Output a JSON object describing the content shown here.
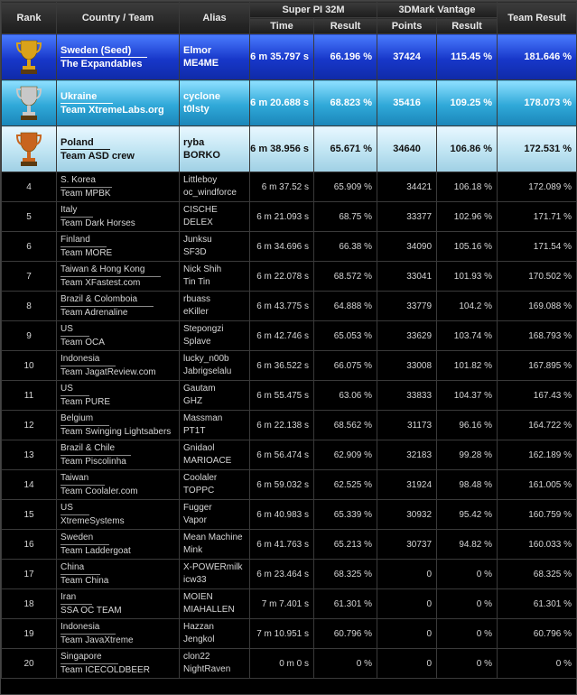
{
  "header": {
    "rank": "Rank",
    "country_team": "Country / Team",
    "alias": "Alias",
    "superpi": "Super PI 32M",
    "vantage": "3DMark Vantage",
    "team_result": "Team Result",
    "time": "Time",
    "result": "Result",
    "points": "Points",
    "result2": "Result"
  },
  "colors": {
    "gold": "#d9a21a",
    "silver": "#c8c8c8",
    "bronze": "#c8641e"
  },
  "podium": [
    {
      "icon": "gold-trophy-icon",
      "country": "Sweden (Seed)",
      "team": "The Expandables",
      "alias1": "Elmor",
      "alias2": "ME4ME",
      "time": "6 m 35.797 s",
      "spi": "66.196 %",
      "points": "37424",
      "vres": "115.45 %",
      "team_result": "181.646 %"
    },
    {
      "icon": "silver-trophy-icon",
      "country": "Ukraine",
      "team": "Team XtremeLabs.org",
      "alias1": "cyclone",
      "alias2": "t0lsty",
      "time": "6 m 20.688 s",
      "spi": "68.823 %",
      "points": "35416",
      "vres": "109.25 %",
      "team_result": "178.073 %"
    },
    {
      "icon": "bronze-trophy-icon",
      "country": "Poland",
      "team": "Team ASD crew",
      "alias1": "ryba",
      "alias2": "BORKO",
      "time": "6 m 38.956 s",
      "spi": "65.671 %",
      "points": "34640",
      "vres": "106.86 %",
      "team_result": "172.531 %"
    }
  ],
  "rows": [
    {
      "rank": "4",
      "country": "S. Korea",
      "team": "Team MPBK",
      "alias1": "Littleboy",
      "alias2": "oc_windforce",
      "time": "6 m 37.52 s",
      "spi": "65.909 %",
      "points": "34421",
      "vres": "106.18 %",
      "team_result": "172.089 %"
    },
    {
      "rank": "5",
      "country": "Italy",
      "team": "Team Dark Horses",
      "alias1": "CISCHE",
      "alias2": "DELEX",
      "time": "6 m 21.093 s",
      "spi": "68.75 %",
      "points": "33377",
      "vres": "102.96 %",
      "team_result": "171.71 %"
    },
    {
      "rank": "6",
      "country": "Finland",
      "team": "Team MORE",
      "alias1": "Junksu",
      "alias2": "SF3D",
      "time": "6 m 34.696 s",
      "spi": "66.38 %",
      "points": "34090",
      "vres": "105.16 %",
      "team_result": "171.54 %"
    },
    {
      "rank": "7",
      "country": "Taiwan & Hong Kong",
      "team": "Team XFastest.com",
      "alias1": "Nick Shih",
      "alias2": "Tin Tin",
      "time": "6 m 22.078 s",
      "spi": "68.572 %",
      "points": "33041",
      "vres": "101.93 %",
      "team_result": "170.502 %"
    },
    {
      "rank": "8",
      "country": "Brazil & Colomboia",
      "team": "Team Adrenaline",
      "alias1": "rbuass",
      "alias2": "eKiller",
      "time": "6 m 43.775 s",
      "spi": "64.888 %",
      "points": "33779",
      "vres": "104.2 %",
      "team_result": "169.088 %"
    },
    {
      "rank": "9",
      "country": "US",
      "team": "Team OCA",
      "alias1": "Stepongzi",
      "alias2": "Splave",
      "time": "6 m 42.746 s",
      "spi": "65.053 %",
      "points": "33629",
      "vres": "103.74 %",
      "team_result": "168.793 %"
    },
    {
      "rank": "10",
      "country": "Indonesia",
      "team": "Team JagatReview.com",
      "alias1": "lucky_n00b",
      "alias2": "Jabrigselalu",
      "time": "6 m 36.522 s",
      "spi": "66.075 %",
      "points": "33008",
      "vres": "101.82 %",
      "team_result": "167.895 %"
    },
    {
      "rank": "11",
      "country": "US",
      "team": "Team PURE",
      "alias1": "Gautam",
      "alias2": "GHZ",
      "time": "6 m 55.475 s",
      "spi": "63.06 %",
      "points": "33833",
      "vres": "104.37 %",
      "team_result": "167.43 %"
    },
    {
      "rank": "12",
      "country": "Belgium",
      "team": "Team Swinging Lightsabers",
      "alias1": "Massman",
      "alias2": "PT1T",
      "time": "6 m 22.138 s",
      "spi": "68.562 %",
      "points": "31173",
      "vres": "96.16 %",
      "team_result": "164.722 %"
    },
    {
      "rank": "13",
      "country": "Brazil & Chile",
      "team": "Team Piscolinha",
      "alias1": "Gnidaol",
      "alias2": "MARIOACE",
      "time": "6 m 56.474 s",
      "spi": "62.909 %",
      "points": "32183",
      "vres": "99.28 %",
      "team_result": "162.189 %"
    },
    {
      "rank": "14",
      "country": "Taiwan",
      "team": "Team Coolaler.com",
      "alias1": "Coolaler",
      "alias2": "TOPPC",
      "time": "6 m 59.032 s",
      "spi": "62.525 %",
      "points": "31924",
      "vres": "98.48 %",
      "team_result": "161.005 %"
    },
    {
      "rank": "15",
      "country": "US",
      "team": "XtremeSystems",
      "alias1": "Fugger",
      "alias2": "Vapor",
      "time": "6 m 40.983 s",
      "spi": "65.339 %",
      "points": "30932",
      "vres": "95.42 %",
      "team_result": "160.759 %"
    },
    {
      "rank": "16",
      "country": "Sweden",
      "team": "Team Laddergoat",
      "alias1": "Mean Machine",
      "alias2": "Mink",
      "time": "6 m 41.763 s",
      "spi": "65.213 %",
      "points": "30737",
      "vres": "94.82 %",
      "team_result": "160.033 %"
    },
    {
      "rank": "17",
      "country": "China",
      "team": "Team China",
      "alias1": "X-POWERmilk",
      "alias2": "icw33",
      "time": "6 m 23.464 s",
      "spi": "68.325 %",
      "points": "0",
      "vres": "0 %",
      "team_result": "68.325 %"
    },
    {
      "rank": "18",
      "country": "Iran",
      "team": "SSA OC TEAM",
      "alias1": "MOIEN",
      "alias2": "MIAHALLEN",
      "time": "7 m 7.401 s",
      "spi": "61.301 %",
      "points": "0",
      "vres": "0 %",
      "team_result": "61.301 %"
    },
    {
      "rank": "19",
      "country": "Indonesia",
      "team": "Team JavaXtreme",
      "alias1": "Hazzan",
      "alias2": "Jengkol",
      "time": "7 m 10.951 s",
      "spi": "60.796 %",
      "points": "0",
      "vres": "0 %",
      "team_result": "60.796 %"
    },
    {
      "rank": "20",
      "country": "Singapore",
      "team": "Team ICECOLDBEER",
      "alias1": "clon22",
      "alias2": "NightRaven",
      "time": "0 m 0 s",
      "spi": "0 %",
      "points": "0",
      "vres": "0 %",
      "team_result": "0 %"
    }
  ]
}
